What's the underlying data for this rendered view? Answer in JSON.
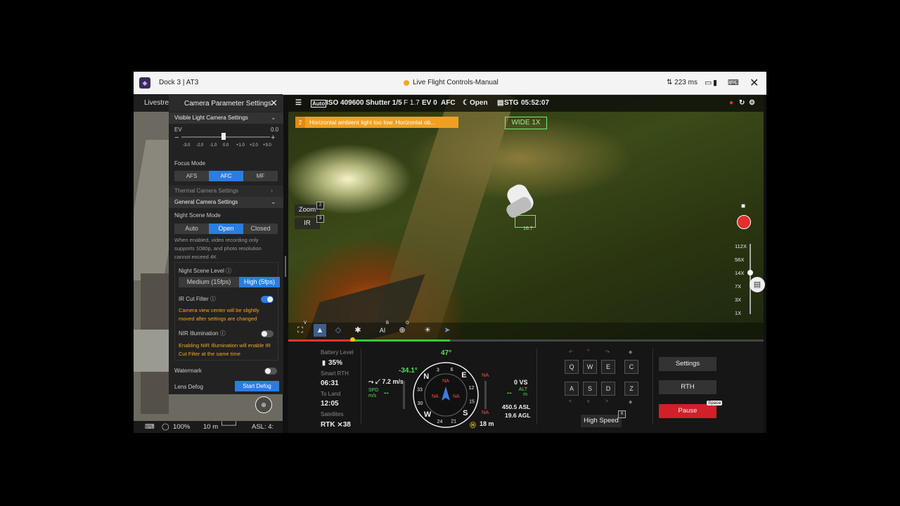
{
  "titlebar": {
    "app_title": "Dock 3 | AT3",
    "mode": "Live Flight Controls-Manual",
    "latency": "223 ms",
    "close_icon": "✕"
  },
  "map": {
    "tab_label": "Livestrea",
    "battery_pct": "100%",
    "scale": "10 m",
    "asl": "ASL: 4:"
  },
  "panel": {
    "title": "Camera Parameter Settings",
    "visible_section": "Visible Light Camera Settings",
    "ev_label": "EV",
    "ev_value": "0.0",
    "ev_ticks": [
      "-3.0",
      "-2.0",
      "-1.0",
      "0.0",
      "+1.0",
      "+2.0",
      "+3.0"
    ],
    "focus_label": "Focus Mode",
    "focus_modes": [
      "AFS",
      "AFC",
      "MF"
    ],
    "focus_selected": "AFC",
    "thermal_section": "Thermal Camera Settings",
    "general_section": "General Camera Settings",
    "night_label": "Night Scene Mode",
    "night_modes": [
      "Auto",
      "Open",
      "Closed"
    ],
    "night_selected": "Open",
    "night_note": "When enabled, video recording only supports 1080p, and photo resolution cannot exceed 4K",
    "night_level_label": "Night Scene Level",
    "night_levels": [
      "Medium (15fps)",
      "High (5fps)"
    ],
    "night_level_selected": "High (5fps)",
    "ir_cut_label": "IR Cut Filter",
    "ir_cut_on": true,
    "ir_cut_note": "Camera view center will be slightly moved after settings are changed",
    "nir_label": "NIR Illumination",
    "nir_on": false,
    "nir_note": "Enabling NIR Illumination will enable IR Cut Filter at the same time",
    "watermark_label": "Watermark",
    "watermark_on": false,
    "defog_label": "Lens Defog",
    "defog_button": "Start Defog"
  },
  "camera_bar": {
    "iso": "ISO 409600",
    "shutter": "Shutter 1/5",
    "fnum": "F 1.7",
    "ev": "EV 0",
    "focus": "AFC",
    "night": "Open",
    "storage": "STG",
    "time": "05:52:07"
  },
  "warning": {
    "index": "2",
    "text": "Horizontal ambient light too low. Horizontal ob..."
  },
  "lens": {
    "mode": "WIDE 1X",
    "track_value": "16.7"
  },
  "side_buttons": [
    {
      "label": "Zoom",
      "key": "2"
    },
    {
      "label": "IR",
      "key": "3"
    }
  ],
  "zoom_levels": [
    "112X",
    "56X",
    "14X",
    "7X",
    "3X",
    "1X"
  ],
  "tools_keys": {
    "t1": "V",
    "t5": "B",
    "t6": "G"
  },
  "stats": {
    "battery_label": "Battery Level",
    "battery_value": "35%",
    "rth_label": "Smart RTH",
    "rth_value": "06:31",
    "land_label": "To Land",
    "land_value": "12:05",
    "sat_label": "Satellites",
    "sat_value": "RTK ⨯38"
  },
  "flight": {
    "heading": "47°",
    "pitch": "-34.1°",
    "speed": "7.2 m/s",
    "spd_label": "SPD m/s",
    "spd_val": "--",
    "vs": "0 VS",
    "alt_label": "ALT m",
    "alt_val": "--",
    "asl": "450.5 ASL",
    "agl": "19.6 AGL",
    "home_dist": "18 m",
    "compass_letters": [
      "N",
      "E",
      "S",
      "W"
    ],
    "compass_nums": [
      "3",
      "6",
      "12",
      "15",
      "21",
      "24",
      "30",
      "33"
    ],
    "na": "NA"
  },
  "keys": {
    "row1": [
      "Q",
      "W",
      "E",
      "C"
    ],
    "row2": [
      "A",
      "S",
      "D",
      "Z"
    ]
  },
  "controls": {
    "settings": "Settings",
    "rth": "RTH",
    "pause": "Pause",
    "pause_key": "Space",
    "high_speed": "High Speed",
    "hs_key": "X"
  }
}
